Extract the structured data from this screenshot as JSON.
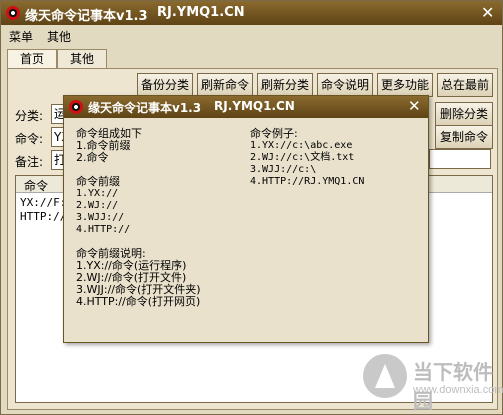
{
  "app": {
    "title": "缘天命令记事本v1.3",
    "url": "RJ.YMQ1.CN"
  },
  "menu": {
    "items": [
      "菜单",
      "其他"
    ]
  },
  "tabs": [
    {
      "label": "首页"
    },
    {
      "label": "其他"
    }
  ],
  "toolbar": {
    "buttons": [
      "备份分类",
      "刷新命令",
      "刷新分类",
      "命令说明",
      "更多功能",
      "总在最前"
    ]
  },
  "side_buttons": {
    "delete_category": "删除分类",
    "copy_command": "复制命令"
  },
  "form": {
    "category_label": "分类:",
    "category_value": "运",
    "command_label": "命令:",
    "command_value": "YX",
    "note_label": "备注:",
    "note_value": "打"
  },
  "list": {
    "header": "命令",
    "rows": [
      "YX://F:",
      "HTTP://"
    ]
  },
  "dialog": {
    "title": "缘天命令记事本v1.3",
    "url": "RJ.YMQ1.CN",
    "left_lines": [
      "命令组成如下",
      "1.命令前缀",
      "2.命令",
      "",
      "命令前缀",
      "1.YX://",
      "2.WJ://",
      "3.WJJ://",
      "4.HTTP://",
      "",
      "命令前缀说明:",
      "1.YX://命令(运行程序)",
      "2.WJ://命令(打开文件)",
      "3.WJJ://命令(打开文件夹)",
      "4.HTTP://命令(打开网页)"
    ],
    "right_lines": [
      "命令例子:",
      "1.YX://c:\\abc.exe",
      "2.WJ://c:\\文档.txt",
      "3.WJJ://c:\\",
      "4.HTTP://RJ.YMQ1.CN"
    ]
  },
  "watermark": {
    "title": "当下软件园",
    "sub": "www.downxia.com"
  }
}
